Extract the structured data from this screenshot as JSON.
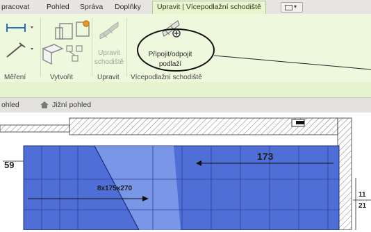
{
  "tabs": [
    {
      "label": "pracovat"
    },
    {
      "label": "Pohled"
    },
    {
      "label": "Správa"
    },
    {
      "label": "Doplňky"
    },
    {
      "label": "Upravit | Vícepodlažní schodiště",
      "active": true
    }
  ],
  "ribbon": {
    "groups": {
      "measure": "Měření",
      "create": "Vytvořit",
      "edit": "Upravit",
      "multistory": "Vícepodlažní schodiště"
    },
    "buttons": {
      "edit_stair_line1": "Upravit",
      "edit_stair_line2": "schodiště",
      "connect_line1": "Připojit/odpojit",
      "connect_line2": "podlaží"
    }
  },
  "view_bar": {
    "left_tab": "ohled",
    "view_tab": "Jižní pohled"
  },
  "drawing": {
    "dim_left": "59",
    "stair_label": "8x175x270",
    "dim_173": "173",
    "dim_11": "11",
    "dim_21": "21"
  },
  "colors": {
    "ribbon_bg": "#eef8dc",
    "active_tab": "#e8f6cf",
    "stair_fill": "#4f6fd6"
  }
}
